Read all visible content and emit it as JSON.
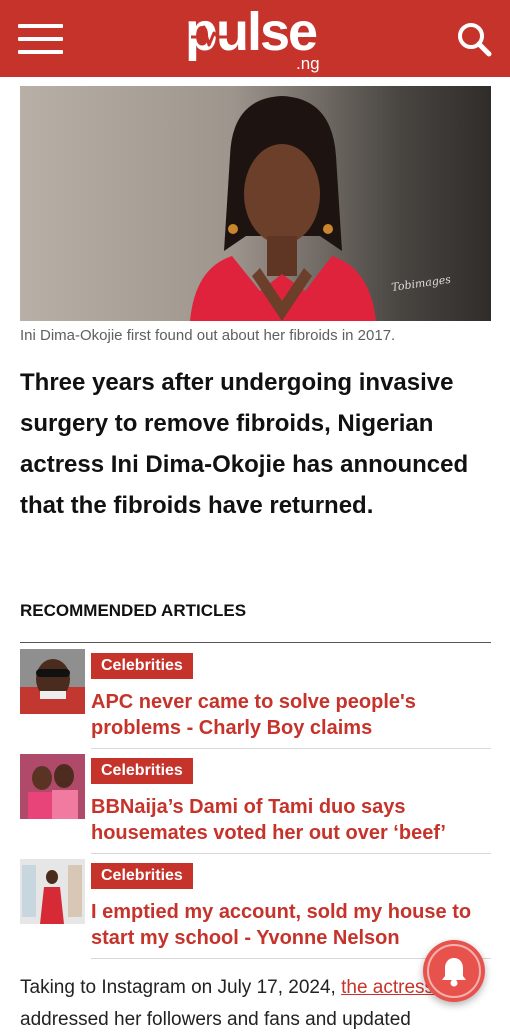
{
  "header": {
    "logo_text": "pulse",
    "logo_tld": ".ng",
    "menu_icon": "hamburger-menu-icon",
    "search_icon": "search-icon",
    "brand_color": "#c6332b"
  },
  "article": {
    "image_caption": "Ini Dima-Okojie first found out about her fibroids in 2017.",
    "image_watermark": "Tobimages",
    "lead": "Three years after undergoing invasive surgery to remove fibroids, Nigerian actress Ini Dima-Okojie has announced that the fibroids have returned.",
    "body_start": "Taking to Instagram on July 17, 2024, ",
    "body_link": "the actress",
    "body_rest": " addressed her followers and fans and updated"
  },
  "recommended": {
    "heading": "RECOMMENDED ARTICLES",
    "items": [
      {
        "category": "Celebrities",
        "title": "APC never came to solve people's problems - Charly Boy claims"
      },
      {
        "category": "Celebrities",
        "title": "BBNaija’s Dami of Tami duo says housemates voted her out over ‘beef’"
      },
      {
        "category": "Celebrities",
        "title": "I emptied my account, sold my house to start my school - Yvonne Nelson"
      }
    ]
  },
  "notification": {
    "icon": "bell-icon",
    "color": "#e8524c"
  }
}
